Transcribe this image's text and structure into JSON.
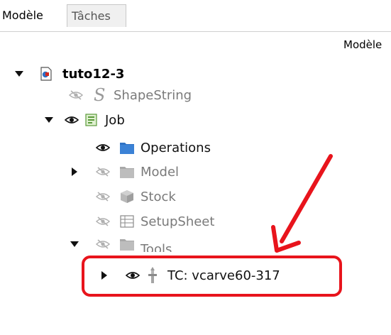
{
  "tabs": [
    {
      "label": "Modèle",
      "active": true
    },
    {
      "label": "Tâches",
      "active": false
    }
  ],
  "panel_label": "Modèle",
  "tree": {
    "root": {
      "label": "tuto12-3",
      "icon": "document-icon"
    },
    "shapestring": {
      "label": "ShapeString",
      "icon": "shapestring-icon"
    },
    "job": {
      "label": "Job",
      "icon": "job-icon"
    },
    "operations": {
      "label": "Operations",
      "icon": "folder-icon"
    },
    "model": {
      "label": "Model",
      "icon": "folder-icon"
    },
    "stock": {
      "label": "Stock",
      "icon": "stock-cube-icon"
    },
    "setupsheet": {
      "label": "SetupSheet",
      "icon": "spreadsheet-icon"
    },
    "tools": {
      "label": "Tools",
      "icon": "folder-icon"
    },
    "toolcontroller": {
      "label": "TC: vcarve60-317",
      "icon": "tool-bit-icon"
    }
  },
  "colors": {
    "annotation_red": "#e8141c",
    "dim_text": "#7a7a7a",
    "folder_blue": "#2f72c4"
  }
}
